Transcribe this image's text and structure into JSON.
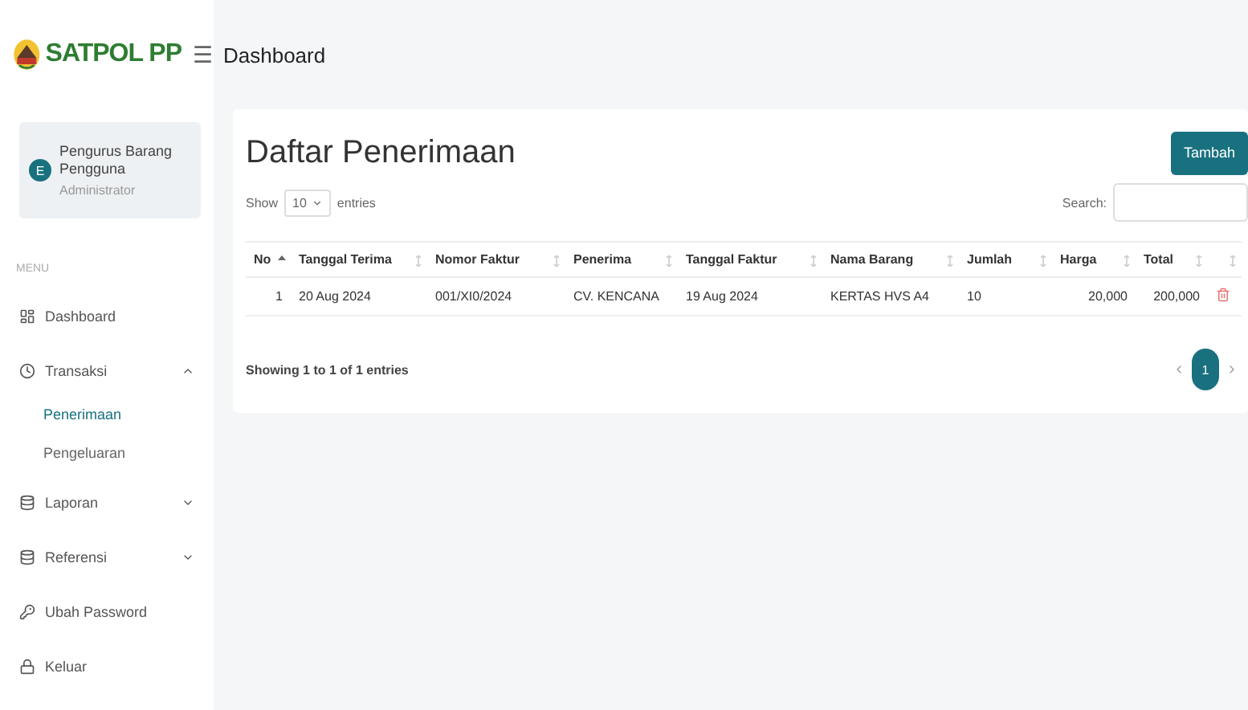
{
  "brand": {
    "name": "SATPOL PP",
    "menu_toggle": "☰"
  },
  "header": {
    "title": "Dashboard"
  },
  "user": {
    "initial": "E",
    "name": "Pengurus Barang Pengguna",
    "role": "Administrator"
  },
  "menu_label": "MENU",
  "nav": [
    {
      "label": "Dashboard",
      "kind": "dashboard",
      "selected": false
    },
    {
      "label": "Transaksi",
      "kind": "clock",
      "selected": false,
      "expanded": true,
      "children": [
        {
          "label": "Penerimaan",
          "selected": true
        },
        {
          "label": "Pengeluaran",
          "selected": false
        }
      ]
    },
    {
      "label": "Laporan",
      "kind": "database",
      "selected": false,
      "expanded": false
    },
    {
      "label": "Referensi",
      "kind": "database",
      "selected": false,
      "expanded": false
    },
    {
      "label": "Ubah Password",
      "kind": "key",
      "selected": false
    },
    {
      "label": "Keluar",
      "kind": "lock",
      "selected": false
    }
  ],
  "card": {
    "title": "Daftar Penerimaan",
    "add_button": "Tambah",
    "show_label": "Show",
    "page_size": "10",
    "entries_label": "entries",
    "search_label": "Search:",
    "columns": [
      {
        "label": "No",
        "sorted": true
      },
      {
        "label": "Tanggal Terima",
        "sorted": false
      },
      {
        "label": "Nomor Faktur",
        "sorted": false
      },
      {
        "label": "Penerima",
        "sorted": false
      },
      {
        "label": "Tanggal Faktur",
        "sorted": false
      },
      {
        "label": "Nama Barang",
        "sorted": false
      },
      {
        "label": "Jumlah",
        "sorted": false
      },
      {
        "label": "Harga",
        "sorted": false
      },
      {
        "label": "Total",
        "sorted": false
      },
      {
        "sorted": false
      }
    ],
    "rows": [
      {
        "cells": [
          "1",
          "20 Aug 2024",
          "001/XI0/2024",
          "CV. KENCANA",
          "19 Aug 2024",
          "KERTAS HVS A4",
          "10",
          "20,000",
          "200,000"
        ]
      }
    ],
    "info": "Showing 1 to 1 of 1 entries",
    "pages": [
      {
        "label": "1",
        "selected": true
      }
    ]
  }
}
